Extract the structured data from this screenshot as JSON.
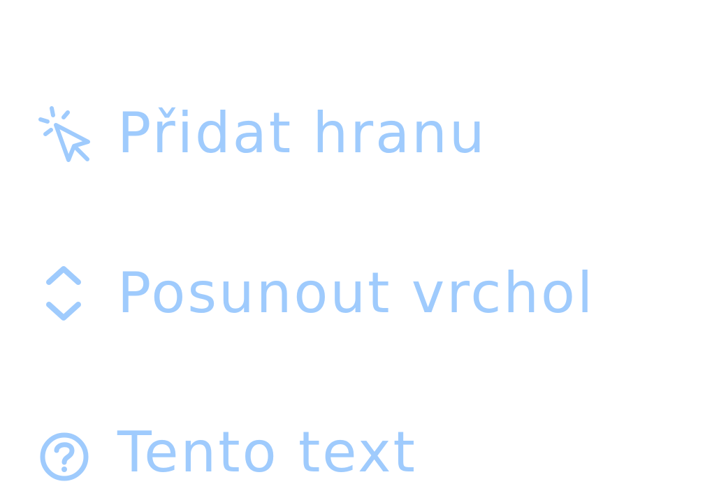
{
  "colors": {
    "accent": "#9fcbfd",
    "background": "#ffffff"
  },
  "menu": {
    "items": [
      {
        "label": "Přidat hranu",
        "icon": "cursor-click-icon"
      },
      {
        "label": "Posunout vrchol",
        "icon": "chevron-up-down-icon"
      },
      {
        "label": "Tento text",
        "icon": "help-circle-icon"
      }
    ]
  }
}
